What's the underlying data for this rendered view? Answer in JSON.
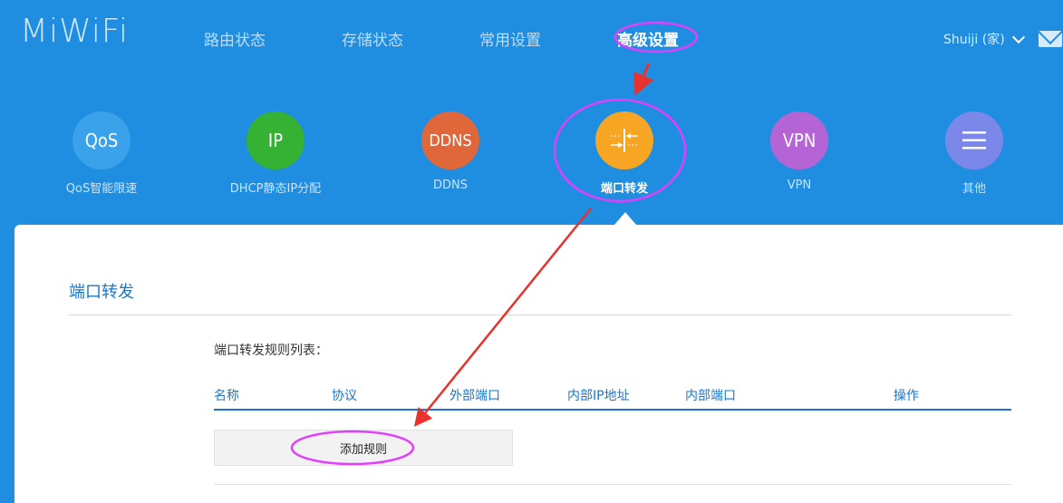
{
  "header": {
    "logo": "MiWiFi",
    "nav": [
      {
        "label": "路由状态",
        "active": false
      },
      {
        "label": "存储状态",
        "active": false
      },
      {
        "label": "常用设置",
        "active": false
      },
      {
        "label": "高级设置",
        "active": true
      }
    ],
    "user": "Shuiji (家)"
  },
  "features": [
    {
      "icon_text": "QoS",
      "label": "QoS智能限速",
      "color": "#3aa2ea",
      "icon": "qos-icon"
    },
    {
      "icon_text": "IP",
      "label": "DHCP静态IP分配",
      "color": "#35b234",
      "icon": "ip-icon"
    },
    {
      "icon_text": "DDNS",
      "label": "DDNS",
      "color": "#e0673a",
      "icon": "ddns-icon"
    },
    {
      "icon_text": "",
      "label": "端口转发",
      "color": "#f7a623",
      "icon": "port-forward-icon",
      "active": true
    },
    {
      "icon_text": "VPN",
      "label": "VPN",
      "color": "#b564d6",
      "icon": "vpn-icon"
    },
    {
      "icon_text": "",
      "label": "其他",
      "color": "#7b88ea",
      "icon": "menu-icon"
    }
  ],
  "panel": {
    "title": "端口转发",
    "list_title": "端口转发规则列表：",
    "columns": [
      "名称",
      "协议",
      "外部端口",
      "内部IP地址",
      "内部端口",
      "操作"
    ],
    "add_button": "添加规则"
  },
  "colors": {
    "background": "#1f8ee0",
    "accent": "#1a76c6",
    "annotation_ellipse": "#e040fb",
    "annotation_arrow": "#e8322d"
  }
}
